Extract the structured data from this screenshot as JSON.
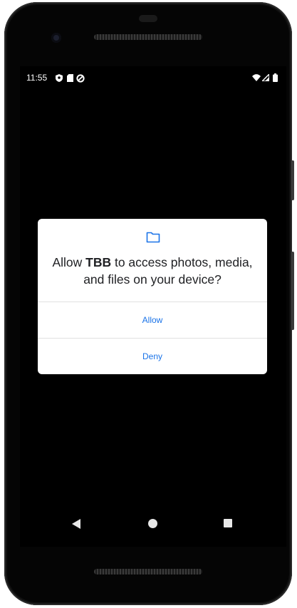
{
  "status_bar": {
    "time": "11:55",
    "left_icons": [
      "shield-icon",
      "sd-card-icon",
      "data-saver-icon"
    ],
    "right_icons": [
      "wifi-icon",
      "cell-signal-icon",
      "battery-icon"
    ]
  },
  "dialog": {
    "icon": "folder-icon",
    "message_prefix": "Allow ",
    "app_name": "TBB",
    "message_suffix": " to access photos, media, and files on your device?",
    "allow_label": "Allow",
    "deny_label": "Deny",
    "accent_color": "#1a73e8"
  },
  "nav_bar": {
    "icons": [
      "back-icon",
      "home-icon",
      "recents-icon"
    ]
  }
}
